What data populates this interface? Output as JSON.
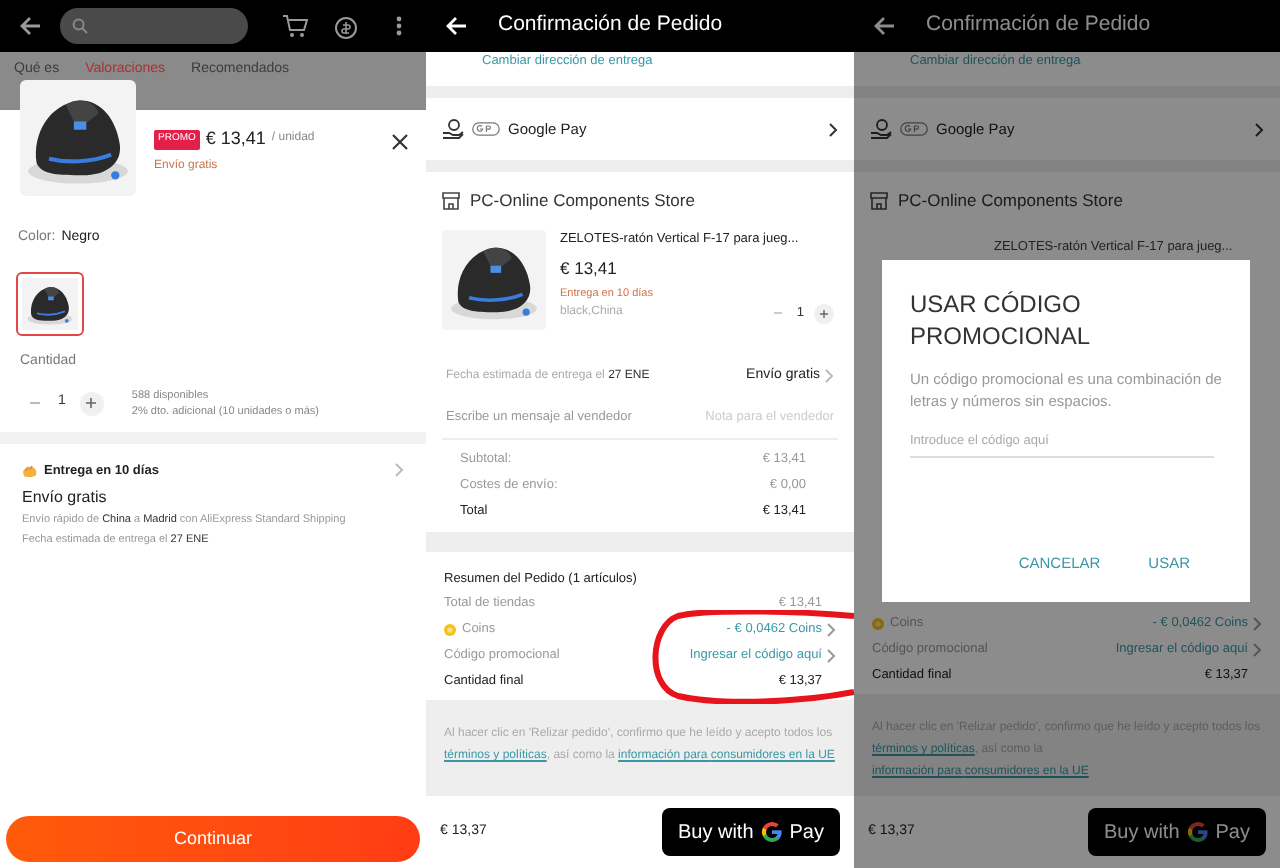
{
  "product_sheet": {
    "tabs": [
      {
        "label": "Qué es",
        "selected": false
      },
      {
        "label": "Valoraciones",
        "selected": true
      },
      {
        "label": "Recomendados",
        "selected": false
      }
    ],
    "promo_badge": "PROMO",
    "price": "€ 13,41",
    "unit": "/ unidad",
    "shipping": "Envío gratis",
    "color_label": "Color:",
    "color_value": "Negro",
    "variants": [
      {
        "selected": true
      }
    ],
    "quantity_label": "Cantidad",
    "quantity": "1",
    "stock": "588 disponibles",
    "discount": "2% dto. adicional (10 unidades o más)",
    "delivery": {
      "title": "Entrega en 10 días",
      "method": "Envío gratis",
      "route": "Envío rápido de **China** a **Madrid** con AliExpress Standard Shipping",
      "estimate": "Fecha estimada de entrega el **27 ENE**"
    },
    "continue_button": "Continuar"
  },
  "order_screen": {
    "title": "Confirmación de Pedido",
    "change_address": "Cambiar dirección de entrega",
    "payment": "Google Pay",
    "store": "PC-Online Components Store",
    "item": {
      "title": "ZELOTES-ratón Vertical F-17 para jueg...",
      "price": "€ 13,41",
      "delivery": "Entrega en 10 días",
      "variant": "black,China",
      "quantity": "1"
    },
    "estimate": "Fecha estimada de entrega el **27 ENE**",
    "shipping": "Envío gratis",
    "message_label": "Escribe un mensaje al vendedor",
    "message_placeholder": "Nota para el vendedor",
    "totals": [
      {
        "kind": "plain",
        "label": "Subtotal:",
        "value": "€ 13,41"
      },
      {
        "kind": "plain",
        "label": "Costes de envío:",
        "value": "€ 0,00"
      },
      {
        "kind": "total",
        "label": "Total",
        "value": "€ 13,41"
      }
    ],
    "summary_title": "Resumen del Pedido (1 artículos)",
    "summary": [
      {
        "kind": "plain",
        "label": "Total de tiendas",
        "value": "€ 13,41"
      },
      {
        "kind": "coins",
        "label": "Coins",
        "value": "- € 0,0462 Coins"
      },
      {
        "kind": "link",
        "label": "Código promocional",
        "value": "Ingresar el código aquí"
      },
      {
        "kind": "total",
        "label": "Cantidad final",
        "value": "€ 13,37"
      }
    ],
    "legal": [
      {
        "text": "Al hacer clic en 'Relizar pedido', confirmo que he leído y acepto todos los ",
        "link": false
      },
      {
        "text": "términos y políticas",
        "link": true
      },
      {
        "text": ", así como la ",
        "link": false
      },
      {
        "text": "información para ",
        "link": true
      },
      {
        "text": "consumidores en la UE",
        "link": true
      }
    ],
    "total": "€ 13,37",
    "pay_button": {
      "before": "Buy with",
      "after": "Pay"
    }
  },
  "dialog_screen": {
    "title": "Confirmación de Pedido",
    "change_address": "Cambiar dirección de entrega",
    "payment": "Google Pay",
    "store": "PC-Online Components Store",
    "item_title": "ZELOTES-ratón Vertical F-17 para jueg...",
    "summary": [
      {
        "kind": "coins",
        "label": "Coins",
        "value": "- € 0,0462 Coins"
      },
      {
        "kind": "link",
        "label": "Código promocional",
        "value": "Ingresar el código aquí"
      },
      {
        "kind": "total",
        "label": "Cantidad final",
        "value": "€ 13,37"
      }
    ],
    "legal": [
      {
        "text": "Al hacer clic en 'Relizar pedido', confirmo que he leído y acepto todos los ",
        "link": false
      },
      {
        "text": "términos y políticas",
        "link": true
      },
      {
        "text": ", así como la ",
        "link": false
      },
      {
        "text": "información para ",
        "link": true
      },
      {
        "text": "consumidores en la UE",
        "link": true
      }
    ],
    "total": "€ 13,37",
    "pay_button": {
      "before": "Buy with",
      "after": "Pay"
    },
    "dialog": {
      "title": "USAR CÓDIGO PROMOCIONAL",
      "message": "Un código promocional es una combinación de letras y números sin espacios.",
      "placeholder": "Introduce el código aquí",
      "buttons": [
        "CANCELAR",
        "USAR"
      ]
    }
  }
}
